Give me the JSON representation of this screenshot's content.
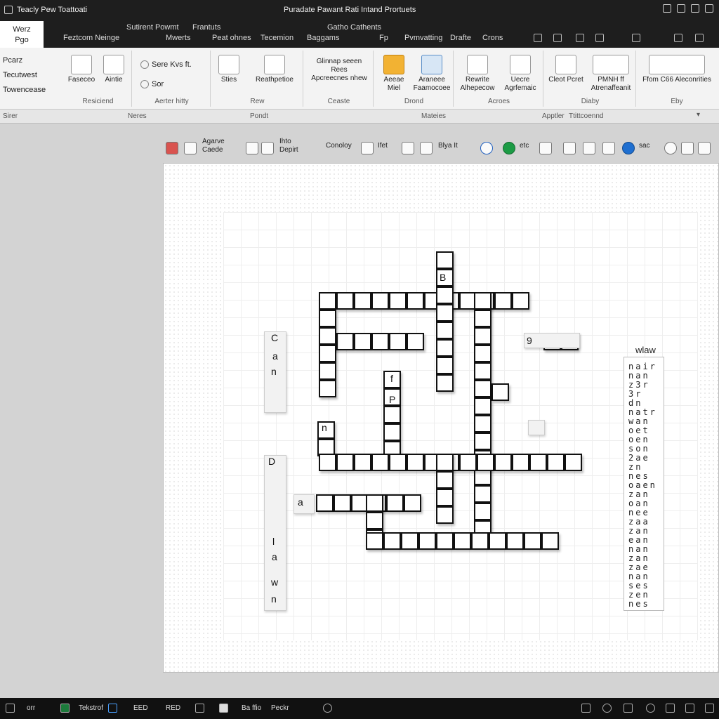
{
  "window": {
    "title": "Teacly Pew Toattoati",
    "doc_title": "Puradate Pawant Rati Intand Prortuets"
  },
  "tabs": {
    "active": [
      "Werz",
      "Pgo"
    ],
    "items": [
      "Feztcom Neinge",
      "Mwerts",
      "Peat ohnes",
      "Tecemion",
      "Baggams",
      "Fp",
      "Pvmvatting",
      "Drafte",
      "Crons"
    ],
    "upper": [
      "Sutirent Powmt",
      "Frantuts",
      "Gatho Cathents"
    ]
  },
  "ribbon": {
    "left_items": [
      "Pcarz",
      "Tecutwest",
      "Towencease"
    ],
    "groups": {
      "clipboard": {
        "label": "Resiciend",
        "btn1": "Faseceo",
        "btn2": "Aintie"
      },
      "font": {
        "label": "Aerter hitty",
        "row1": "Sere Kvs ft.",
        "row2": "Sor"
      },
      "styles": {
        "label": "Rew",
        "btn1": "Sties",
        "btn2": "Reathpetioe"
      },
      "insert": {
        "label": "Ceaste",
        "btn1": "Glinnap seeen",
        "btn2": "Rees",
        "btn3": "Apcreecnes nhew"
      },
      "design": {
        "label": "Drond",
        "btn1": "Aeeae Miel",
        "btn2": "Araneee",
        "btn3": "Faamocoee"
      },
      "layout": {
        "label": "Acroes",
        "btn1": "Rewrite",
        "btn2": "Alhepecow",
        "btn3": "Uecre",
        "btn4": "Agrfemaic"
      },
      "review": {
        "label": "Diaby",
        "btn1": "Cleot Pcret",
        "btn2": "Atrenaffeanit",
        "btn3": "PMNH ff"
      },
      "view": {
        "label": "Eby",
        "btn1": "Ffom C66 Aleconrities"
      }
    }
  },
  "ribbon_footer": [
    "Sirer",
    "Neres",
    "Pondt",
    "Mateies",
    "Apptler",
    "Ttittcoennd"
  ],
  "toolbar2": {
    "items": [
      "Agarve Caede",
      "Ihto Depirt",
      "Conoloy",
      "Ifet",
      "Blya It",
      "etc",
      "sac"
    ]
  },
  "crossword": {
    "letters": [
      "B",
      "C",
      "a",
      "n",
      "9",
      "f",
      "P",
      "n",
      "D",
      "a",
      "l",
      "a",
      "w",
      "n"
    ],
    "word_column": {
      "header": "wlaw",
      "rows": [
        "nair",
        "nan",
        "z3r",
        "3r",
        "dn",
        "natr",
        "wan",
        "oet",
        "oen",
        "son",
        "2ae",
        "zn",
        "nes",
        "oaen",
        "zan",
        "oan",
        "nee",
        "zaa",
        "zan",
        "ean",
        "nan",
        "zan",
        "zae",
        "nan",
        "ses",
        "zen",
        "nes"
      ]
    }
  },
  "taskbar": {
    "items": [
      "orr",
      "Tekstrof",
      "EED",
      "RED",
      "Ba ffio",
      "Peckr"
    ]
  }
}
